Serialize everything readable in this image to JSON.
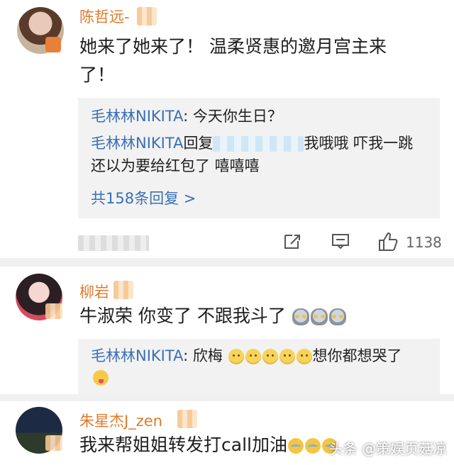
{
  "comments": [
    {
      "username": "陈哲远-",
      "text": "她来了她来了！ 温柔贤惠的邀月宫主来了！",
      "replies": [
        {
          "user": "毛林林NIKITA",
          "text": ": 今天你生日？"
        },
        {
          "user": "毛林林NIKITA",
          "prefix": "回复",
          "text": "我哦哦 吓我一跳 还以为要给红包了 嘻嘻嘻"
        }
      ],
      "more_replies": "共158条回复 >",
      "likes": "1138"
    },
    {
      "username": "柳岩",
      "text": "牛淑荣 你变了 不跟我斗了",
      "replies": [
        {
          "user": "毛林林NIKITA",
          "text": ": 欣梅",
          "text_after": "想你都想哭了"
        }
      ]
    },
    {
      "username": "朱星杰J_zen",
      "text": "我来帮姐姐转发打call加油"
    }
  ],
  "watermark": "头条 @策娱页菇凉",
  "colors": {
    "username": "#e07a2b",
    "reply_user": "#3a6fb5",
    "reply_bg": "#f2f2f2"
  },
  "icons": [
    "share-icon",
    "comment-icon",
    "thumbs-up-icon"
  ]
}
